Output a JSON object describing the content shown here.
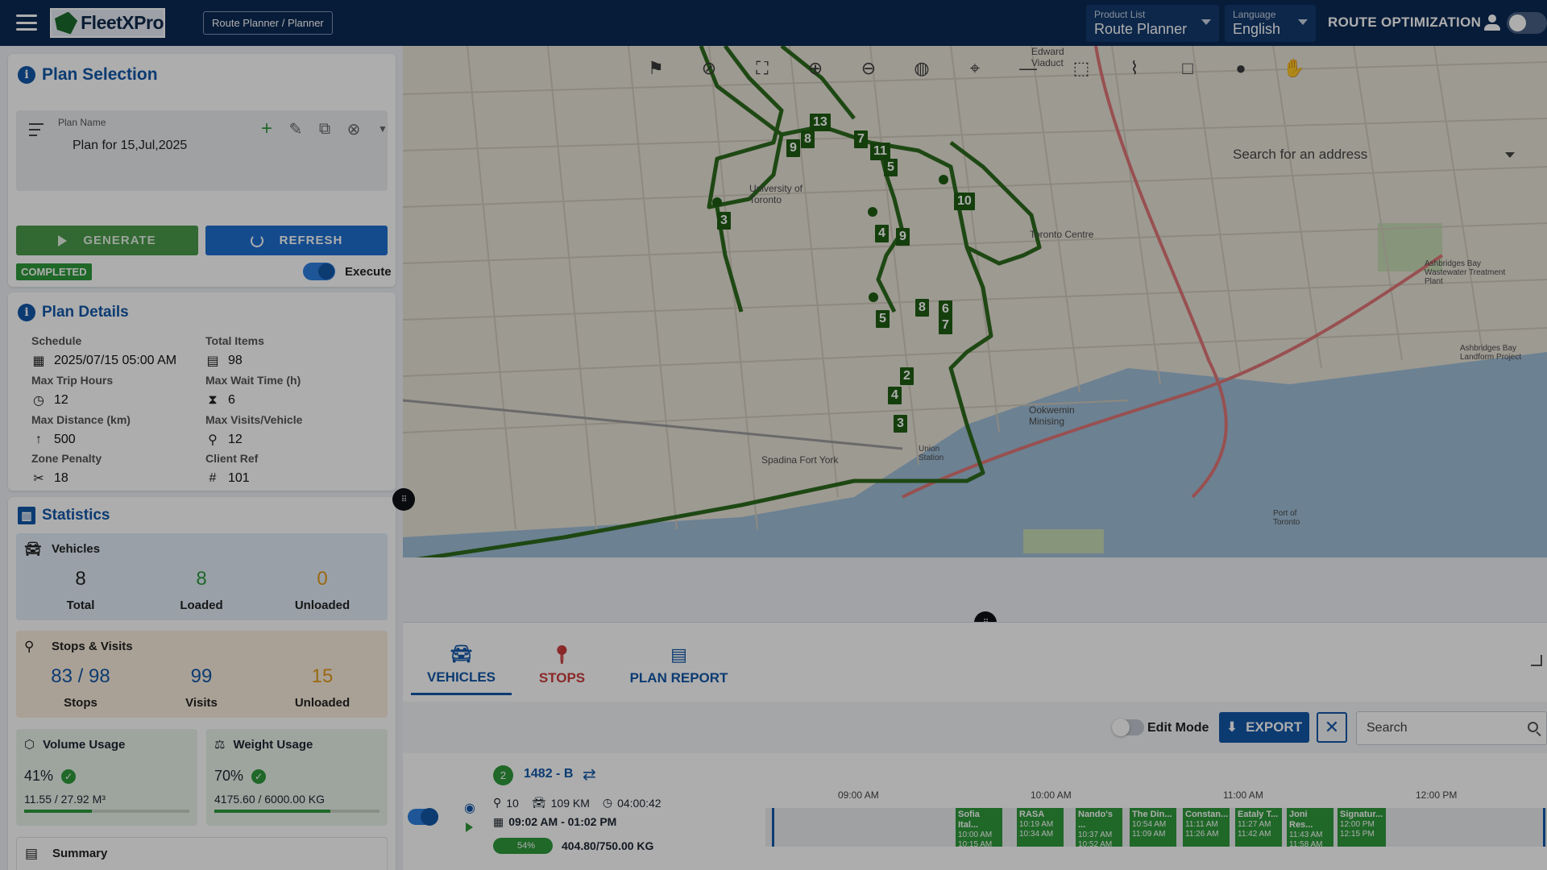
{
  "header": {
    "app_name": "FleetXPro",
    "breadcrumb": "Route Planner / Planner",
    "product_list": {
      "label": "Product List",
      "value": "Route Planner"
    },
    "language": {
      "label": "Language",
      "value": "English"
    },
    "route_optimization": "ROUTE OPTIMIZATION",
    "colors": {
      "topbar": "#0b2a55",
      "accent": "#1257a8",
      "success": "#2f9a3c"
    }
  },
  "plan_selection": {
    "title": "Plan Selection",
    "plan_name_label": "Plan Name",
    "plan_name_value": "Plan for 15,Jul,2025",
    "generate_label": "GENERATE",
    "refresh_label": "REFRESH",
    "status_badge": "COMPLETED",
    "execute_label": "Execute"
  },
  "plan_details": {
    "title": "Plan Details",
    "schedule": {
      "label": "Schedule",
      "value": "2025/07/15 05:00 AM"
    },
    "total_items": {
      "label": "Total Items",
      "value": "98"
    },
    "max_trip_hours": {
      "label": "Max Trip Hours",
      "value": "12"
    },
    "max_wait_time": {
      "label": "Max Wait Time (h)",
      "value": "6"
    },
    "max_distance": {
      "label": "Max Distance (km)",
      "value": "500"
    },
    "max_visits": {
      "label": "Max Visits/Vehicle",
      "value": "12"
    },
    "zone_penalty": {
      "label": "Zone Penalty",
      "value": "18"
    },
    "client_ref": {
      "label": "Client Ref",
      "value": "101"
    }
  },
  "statistics": {
    "title": "Statistics",
    "vehicles": {
      "title": "Vehicles",
      "total": {
        "num": "8",
        "cap": "Total"
      },
      "loaded": {
        "num": "8",
        "cap": "Loaded"
      },
      "unloaded": {
        "num": "0",
        "cap": "Unloaded"
      }
    },
    "stops_visits": {
      "title": "Stops & Visits",
      "stops": {
        "num": "83 / 98",
        "cap": "Stops"
      },
      "visits": {
        "num": "99",
        "cap": "Visits"
      },
      "unloaded": {
        "num": "15",
        "cap": "Unloaded"
      }
    },
    "volume": {
      "title": "Volume Usage",
      "pct": "41%",
      "amount": "11.55 / 27.92 M³",
      "fraction": 0.41
    },
    "weight": {
      "title": "Weight Usage",
      "pct": "70%",
      "amount": "4175.60 / 6000.00 KG",
      "fraction": 0.7
    },
    "summary_title": "Summary"
  },
  "map": {
    "search_placeholder": "Search for an address",
    "stop_labels": [
      "13",
      "8",
      "9",
      "7",
      "11",
      "5",
      "10",
      "3",
      "4",
      "9",
      "5",
      "8",
      "6",
      "7",
      "2",
      "4",
      "3"
    ],
    "place_labels": [
      "Toronto Centre",
      "University of Toronto",
      "Spadina Fort York",
      "Ookwemin Minising",
      "Ashbridges Bay Wastewater Treatment Plant",
      "Ashbridges Bay Landform Project",
      "Port of Toronto",
      "Edward Viaduct",
      "Union Station"
    ],
    "tools": [
      "flag-icon",
      "pin-off-icon",
      "fullscreen-icon",
      "zoom-in-icon",
      "zoom-out-icon",
      "globe-icon",
      "locate-icon",
      "line-tool-icon",
      "select-icon",
      "polyline-icon",
      "rectangle-icon",
      "circle-icon",
      "pan-hand-icon"
    ]
  },
  "tabs": {
    "vehicles": "VEHICLES",
    "stops": "STOPS",
    "plan_report": "PLAN REPORT"
  },
  "toolbar": {
    "edit_mode": "Edit Mode",
    "export": "EXPORT",
    "search_placeholder": "Search"
  },
  "vehicle_row": {
    "number": "2",
    "name": "1482 - B",
    "stops": "10",
    "distance": "109 KM",
    "duration": "04:00:42",
    "time_window": "09:02 AM - 01:02 PM",
    "weight_pct": "54%",
    "weight": "404.80/750.00 KG",
    "timeline_ticks": [
      "09:00 AM",
      "10:00 AM",
      "11:00 AM",
      "12:00 PM"
    ],
    "timeline_blocks": [
      {
        "name": "Sofia Ital...",
        "start": "10:00 AM",
        "end": "10:15 AM"
      },
      {
        "name": "RASA",
        "start": "10:19 AM",
        "end": "10:34 AM"
      },
      {
        "name": "Nando's ...",
        "start": "10:37 AM",
        "end": "10:52 AM"
      },
      {
        "name": "The Din...",
        "start": "10:54 AM",
        "end": "11:09 AM"
      },
      {
        "name": "Constan...",
        "start": "11:11 AM",
        "end": "11:26 AM"
      },
      {
        "name": "Eataly T...",
        "start": "11:27 AM",
        "end": "11:42 AM"
      },
      {
        "name": "Joni Res...",
        "start": "11:43 AM",
        "end": "11:58 AM"
      },
      {
        "name": "Signatur...",
        "start": "12:00 PM",
        "end": "12:15 PM"
      }
    ]
  }
}
